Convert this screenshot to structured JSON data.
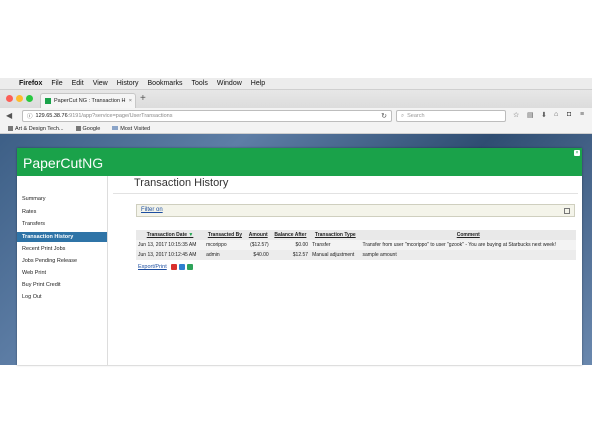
{
  "menubar": {
    "apple": "",
    "app": "Firefox",
    "items": [
      "File",
      "Edit",
      "View",
      "History",
      "Bookmarks",
      "Tools",
      "Window",
      "Help"
    ]
  },
  "tab": {
    "title": "PaperCut NG : Transaction H",
    "close": "×",
    "new": "+"
  },
  "navbar": {
    "url_host": "129.65.38.76",
    "url_path": ":9191/app?service=page/UserTransactions",
    "search_placeholder": "Search"
  },
  "bookmarks": [
    "Art & Design Tech...",
    "Google",
    "Most Visited"
  ],
  "papercut": {
    "logo": "PaperCut",
    "logo_suffix": "NG",
    "header_color": "#1aa24a",
    "sidebar": [
      "Summary",
      "Rates",
      "Transfers",
      "Transaction History",
      "Recent Print Jobs",
      "Jobs Pending Release",
      "Web Print",
      "Buy Print Credit",
      "Log Out"
    ],
    "active_index": 3,
    "title": "Transaction History",
    "filter_label": "Filter on",
    "table": {
      "headers": [
        "Transaction Date",
        "Transacted By",
        "Amount",
        "Balance After",
        "Transaction Type",
        "Comment"
      ],
      "rows": [
        [
          "Jun 13, 2017 10:15:35 AM",
          "mcorippo",
          "($12.57)",
          "$0.00",
          "Transfer",
          "Transfer from user \"mcorippo\" to user \"gzook\" - You are buying at Starbucks next week!"
        ],
        [
          "Jun 13, 2017 10:12:45 AM",
          "admin",
          "$40.00",
          "$12.57",
          "Manual adjustment",
          "sample amount"
        ]
      ]
    },
    "export_label": "Export/Print"
  }
}
